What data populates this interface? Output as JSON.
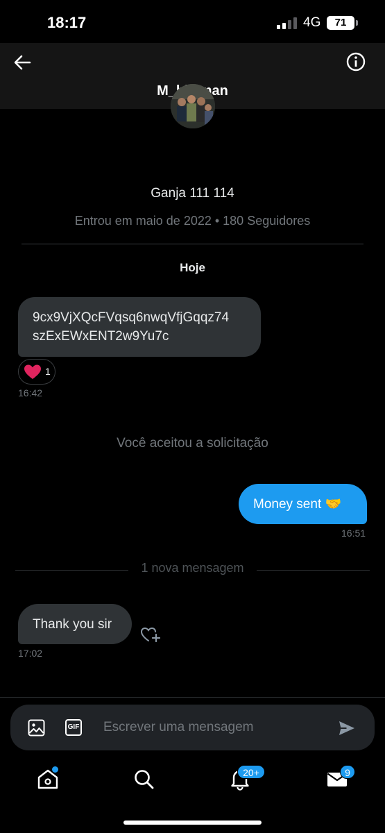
{
  "status": {
    "time": "18:17",
    "network": "4G",
    "battery": "71"
  },
  "header": {
    "username": "M_bl    man"
  },
  "profile": {
    "name": "Ganja 111 114",
    "meta": "Entrou em maio de 2022 • 180 Seguidores"
  },
  "conversation": {
    "day_label": "Hoje",
    "messages": [
      {
        "line1": "9cx9VjXQcFVqsq6nwqVfjGqqz74",
        "line2": "szExEWxENT2w9Yu7c",
        "time": "16:42",
        "reaction_count": "1"
      },
      {
        "system": "Você aceitou a solicitação"
      },
      {
        "text": "Money sent 🤝",
        "time": "16:51"
      },
      {
        "new_label": "1 nova mensagem"
      },
      {
        "text": "Thank you sir",
        "time": "17:02"
      }
    ]
  },
  "composer": {
    "placeholder": "Escrever uma mensagem",
    "gif_label": "GIF"
  },
  "nav": {
    "notifications_badge": "20+",
    "messages_badge": "9"
  },
  "colors": {
    "accent": "#1d9bf0",
    "bubble_in": "#2f3336",
    "reaction": "#e0245e"
  }
}
